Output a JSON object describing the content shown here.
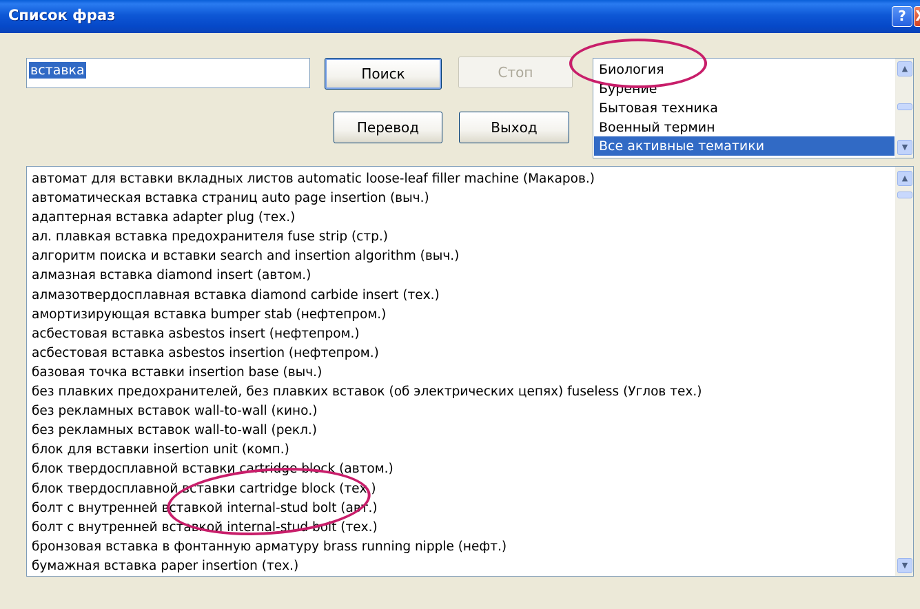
{
  "window": {
    "title": "Список фраз",
    "help_glyph": "?",
    "close_glyph": "X"
  },
  "search": {
    "value": "вставка"
  },
  "buttons": {
    "search": "Поиск",
    "stop": "Стоп",
    "translate": "Перевод",
    "exit": "Выход"
  },
  "topics": {
    "items": [
      "Биология",
      "Бурение",
      "Бытовая техника",
      "Военный термин",
      "Все активные тематики"
    ],
    "selected": "Все активные тематики"
  },
  "results": [
    "автомат для вставки вкладных листов automatic loose-leaf filler machine (Макаров.)",
    "автоматическая вставка страниц auto page insertion (выч.)",
    "адаптерная вставка adapter plug (тех.)",
    "ал. плавкая вставка предохранителя fuse strip (стр.)",
    "алгоритм поиска и вставки search and insertion algorithm (выч.)",
    "алмазная вставка diamond insert (автом.)",
    "алмазотвердосплавная вставка diamond carbide insert (тех.)",
    "амортизирующая вставка bumper stab (нефтепром.)",
    "асбестовая вставка asbestos insert (нефтепром.)",
    "асбестовая вставка asbestos insertion (нефтепром.)",
    "базовая точка вставки insertion base (выч.)",
    "без плавких предохранителей, без плавких вставок (об электрических цепях) fuseless (Углов тех.)",
    "без рекламных вставок wall-to-wall (кино.)",
    "без рекламных вставок wall-to-wall (рекл.)",
    "блок для вставки insertion unit (комп.)",
    "блок твердосплавной вставки cartridge block (автом.)",
    "блок твердосплавной вставки cartridge block (тех.)",
    "болт с внутренней вставкой internal-stud bolt (авт.)",
    "болт с внутренней вставкой internal-stud bolt (тех.)",
    "бронзовая вставка в фонтанную арматуру brass running nipple (нефт.)",
    "бумажная вставка paper insertion (тех.)"
  ],
  "colors": {
    "highlight_circle": "#C81E6A",
    "selection": "#316AC5",
    "window_bg": "#ECE9D8"
  }
}
